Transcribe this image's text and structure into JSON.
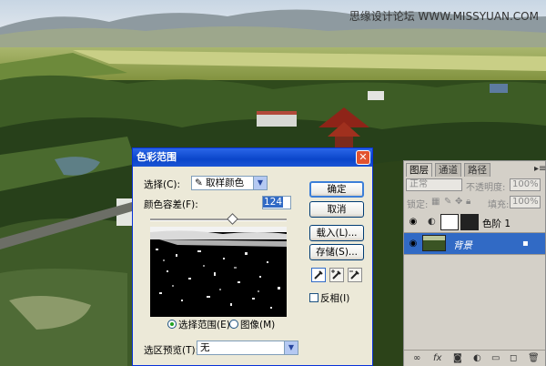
{
  "watermark": "思缘设计论坛 WWW.MISSYUAN.COM",
  "dialog": {
    "title": "色彩范围",
    "select_label": "选择(C):",
    "select_value": "取样颜色",
    "tolerance_label": "颜色容差(F):",
    "tolerance_value": "124",
    "tolerance_level": 0.6,
    "radio_selection": "选择范围(E)",
    "radio_image": "图像(M)",
    "preview_label": "选区预览(T):",
    "preview_value": "无",
    "buttons": {
      "ok": "确定",
      "cancel": "取消",
      "load": "载入(L)...",
      "save": "存储(S)..."
    },
    "invert_label": "反相(I)",
    "icons": [
      "eyedropper-icon",
      "eyedropper-plus-icon",
      "eyedropper-minus-icon",
      "close-icon"
    ]
  },
  "layers_panel": {
    "tabs": [
      "图层",
      "通道",
      "路径"
    ],
    "blend_mode": "正常",
    "opacity_label": "不透明度:",
    "opacity_value": "100%",
    "lock_label": "锁定:",
    "fill_label": "填充:",
    "fill_value": "100%",
    "layers": [
      {
        "name": "色阶 1",
        "selected": false
      },
      {
        "name": "背景",
        "selected": true
      }
    ],
    "accent": "#316AC5"
  }
}
